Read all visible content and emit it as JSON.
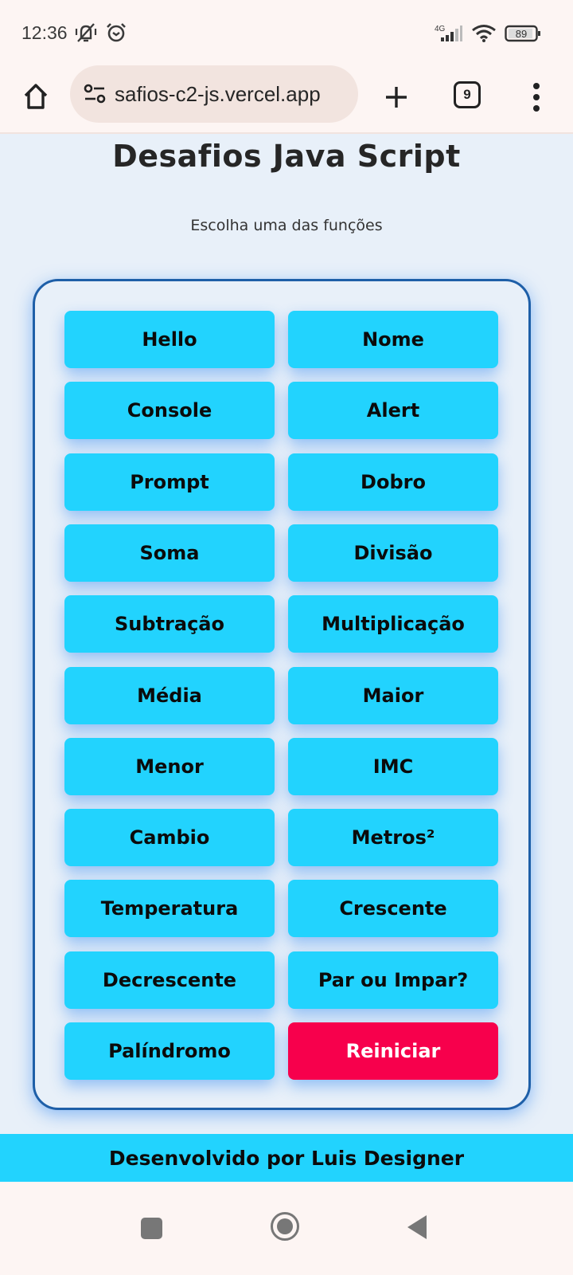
{
  "status_bar": {
    "time": "12:36",
    "icons": [
      "vibrate-silent-icon",
      "alarm-icon"
    ],
    "network": "4G",
    "battery": "89"
  },
  "browser": {
    "url": "safios-c2-js.vercel.app",
    "tab_count": "9"
  },
  "page": {
    "title": "Desafios Java Script",
    "subtitle": "Escolha uma das funções"
  },
  "buttons": [
    {
      "label": "Hello"
    },
    {
      "label": "Nome"
    },
    {
      "label": "Console"
    },
    {
      "label": "Alert"
    },
    {
      "label": "Prompt"
    },
    {
      "label": "Dobro"
    },
    {
      "label": "Soma"
    },
    {
      "label": "Divisão"
    },
    {
      "label": "Subtração"
    },
    {
      "label": "Multiplicação"
    },
    {
      "label": "Média"
    },
    {
      "label": "Maior"
    },
    {
      "label": "Menor"
    },
    {
      "label": "IMC"
    },
    {
      "label": "Cambio"
    },
    {
      "label": "Metros²"
    },
    {
      "label": "Temperatura"
    },
    {
      "label": "Crescente"
    },
    {
      "label": "Decrescente"
    },
    {
      "label": "Par ou Impar?"
    },
    {
      "label": "Palíndromo"
    },
    {
      "label": "Reiniciar",
      "variant": "reset"
    }
  ],
  "colors": {
    "button": "#22d3fe",
    "reset": "#f7004c",
    "card_border": "#1e5fa8",
    "background": "#e8f0f9"
  },
  "footer": {
    "text": "Desenvolvido por Luis Designer"
  }
}
